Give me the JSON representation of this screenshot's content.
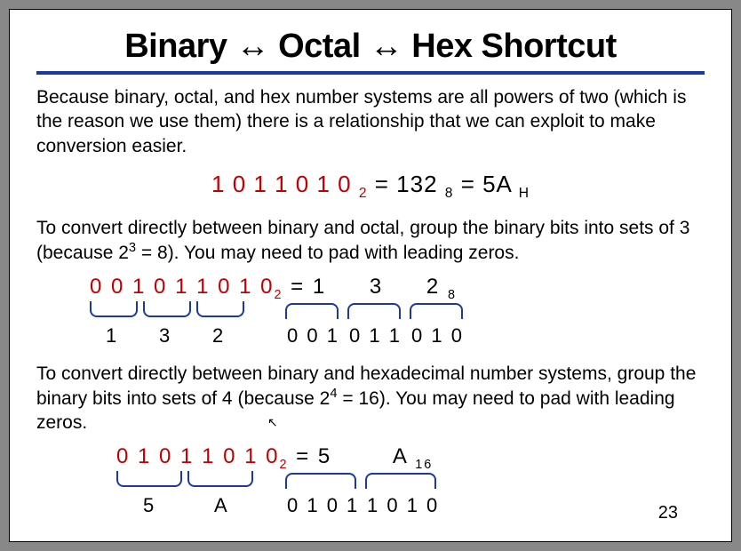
{
  "title": "Binary ↔ Octal ↔ Hex Shortcut",
  "para1": "Because binary, octal, and hex number systems are all powers of two (which is the reason we use them) there is a relationship that we can exploit to make conversion easier.",
  "eq_main": {
    "binary": "1 0 1 1 0 1 0",
    "base2": "2",
    "eq1": " = 132 ",
    "base8": "8",
    "eq2": " = 5A ",
    "baseH": "H"
  },
  "para2_a": "To convert directly between binary and octal, group the binary bits into sets of 3 (because 2",
  "para2_exp": "3",
  "para2_b": " = 8). You may need to pad with leading zeros.",
  "octal_diag": {
    "padded": "0 0 1 0 1 1 0 1 0",
    "base": "2",
    "eq": "= 1",
    "r2": "3",
    "r3": "2",
    "rbase": "8",
    "g1": "1",
    "g2": "3",
    "g3": "2",
    "b1": "0 0 1",
    "b2": "0 1 1",
    "b3": "0 1 0"
  },
  "para3_a": "To convert directly between binary and hexadecimal number systems, group the binary bits into sets of 4 (because 2",
  "para3_exp": "4",
  "para3_b": " = 16). You may need to pad with leading zeros.",
  "hex_diag": {
    "padded": "0 1 0 1 1 0 1 0",
    "base": "2",
    "eq": "= 5",
    "r2": "A",
    "rbase": "16",
    "g1": "5",
    "g2": "A",
    "b1": "0 1 0 1",
    "b2": "1 0 1 0"
  },
  "page_num": "23"
}
